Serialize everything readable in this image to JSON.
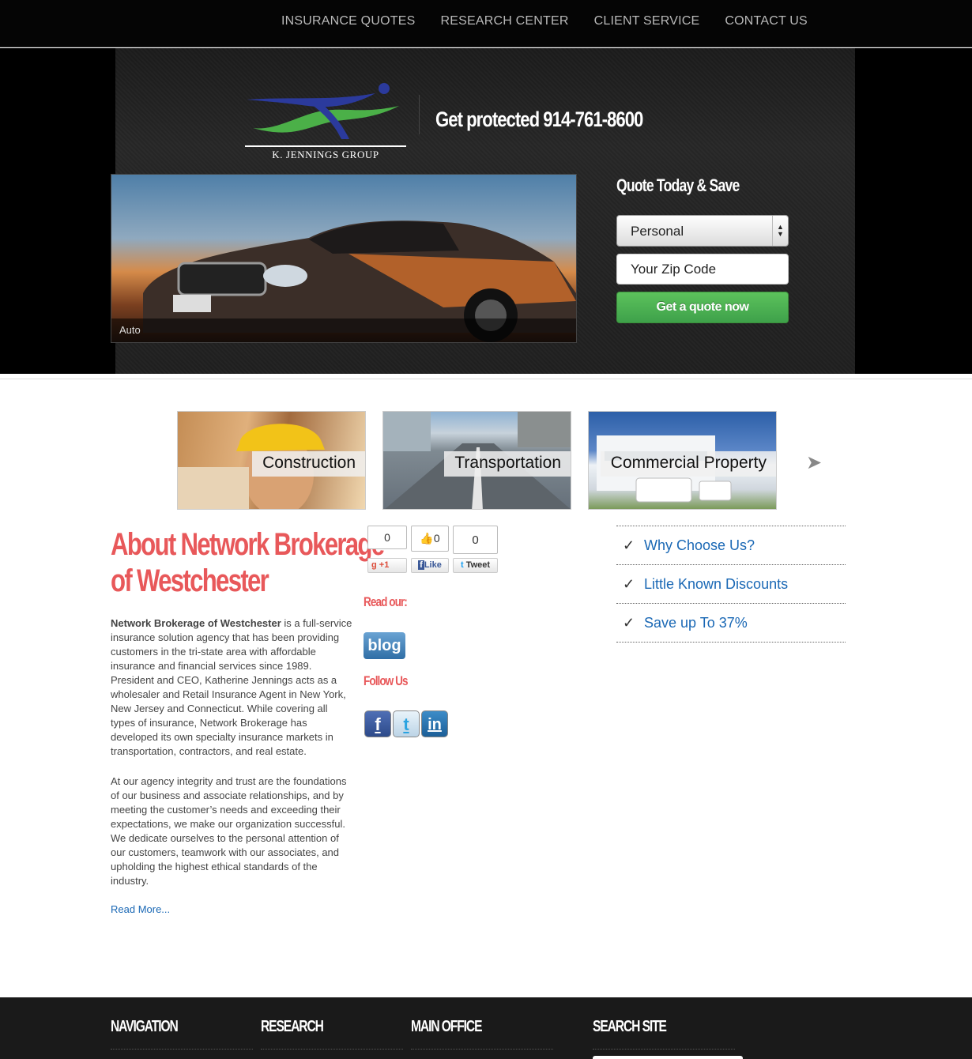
{
  "nav": {
    "items": [
      "INSURANCE QUOTES",
      "RESEARCH CENTER",
      "CLIENT SERVICE",
      "CONTACT US"
    ]
  },
  "header": {
    "logo_text": "K. JENNINGS GROUP",
    "phone_tagline": "Get protected 914-761-8600"
  },
  "slider": {
    "caption": "Auto"
  },
  "quote_form": {
    "title": "Quote Today & Save",
    "type_value": "Personal",
    "zip_placeholder": "Your Zip Code",
    "submit_label": "Get a quote now"
  },
  "tiles": [
    {
      "label": "Construction"
    },
    {
      "label": "Transportation"
    },
    {
      "label": "Commercial Property"
    }
  ],
  "about": {
    "title_line1": "About Network Brokerage",
    "title_line2": "of Westchester",
    "p1_bold": "Network Brokerage of Westchester",
    "p1_rest": " is a full-service insurance solution agency that has been providing customers in the tri-state area with affordable insurance and financial services since 1989. President and CEO, Katherine Jennings acts as a wholesaler and Retail Insurance Agent in New York, New Jersey and Connecticut. While covering all types of insurance, Network Brokerage has developed its own specialty insurance markets in transportation, contractors, and real estate.",
    "p2": "At our agency integrity and trust are the foundations of our business and associate relationships, and by meeting the customer’s needs and exceeding their expectations, we make our organization successful. We dedicate ourselves to the personal attention of our customers, teamwork with our associates, and upholding the highest ethical standards of the industry.",
    "read_more": "Read More..."
  },
  "social": {
    "gplus_count": "0",
    "gplus_label": "+1",
    "like_count": "0",
    "like_label": "Like",
    "tweet_count": "0",
    "tweet_label": "Tweet",
    "read_our": "Read our:",
    "blog_label": "blog",
    "follow_us": "Follow Us",
    "icons": [
      "facebook-icon",
      "twitter-icon",
      "linkedin-icon"
    ]
  },
  "benefits": [
    {
      "check": "✓",
      "label": "Why Choose Us?"
    },
    {
      "check": "✓",
      "label": "Little Known Discounts"
    },
    {
      "check": "✓",
      "label": "Save up To 37%"
    }
  ],
  "footer": {
    "cols": [
      "NAVIGATION",
      "RESEARCH",
      "MAIN OFFICE",
      "SEARCH SITE"
    ]
  },
  "colors": {
    "accent_red": "#e8585a",
    "link_blue": "#1a68b5",
    "button_green": "#4cb450"
  }
}
